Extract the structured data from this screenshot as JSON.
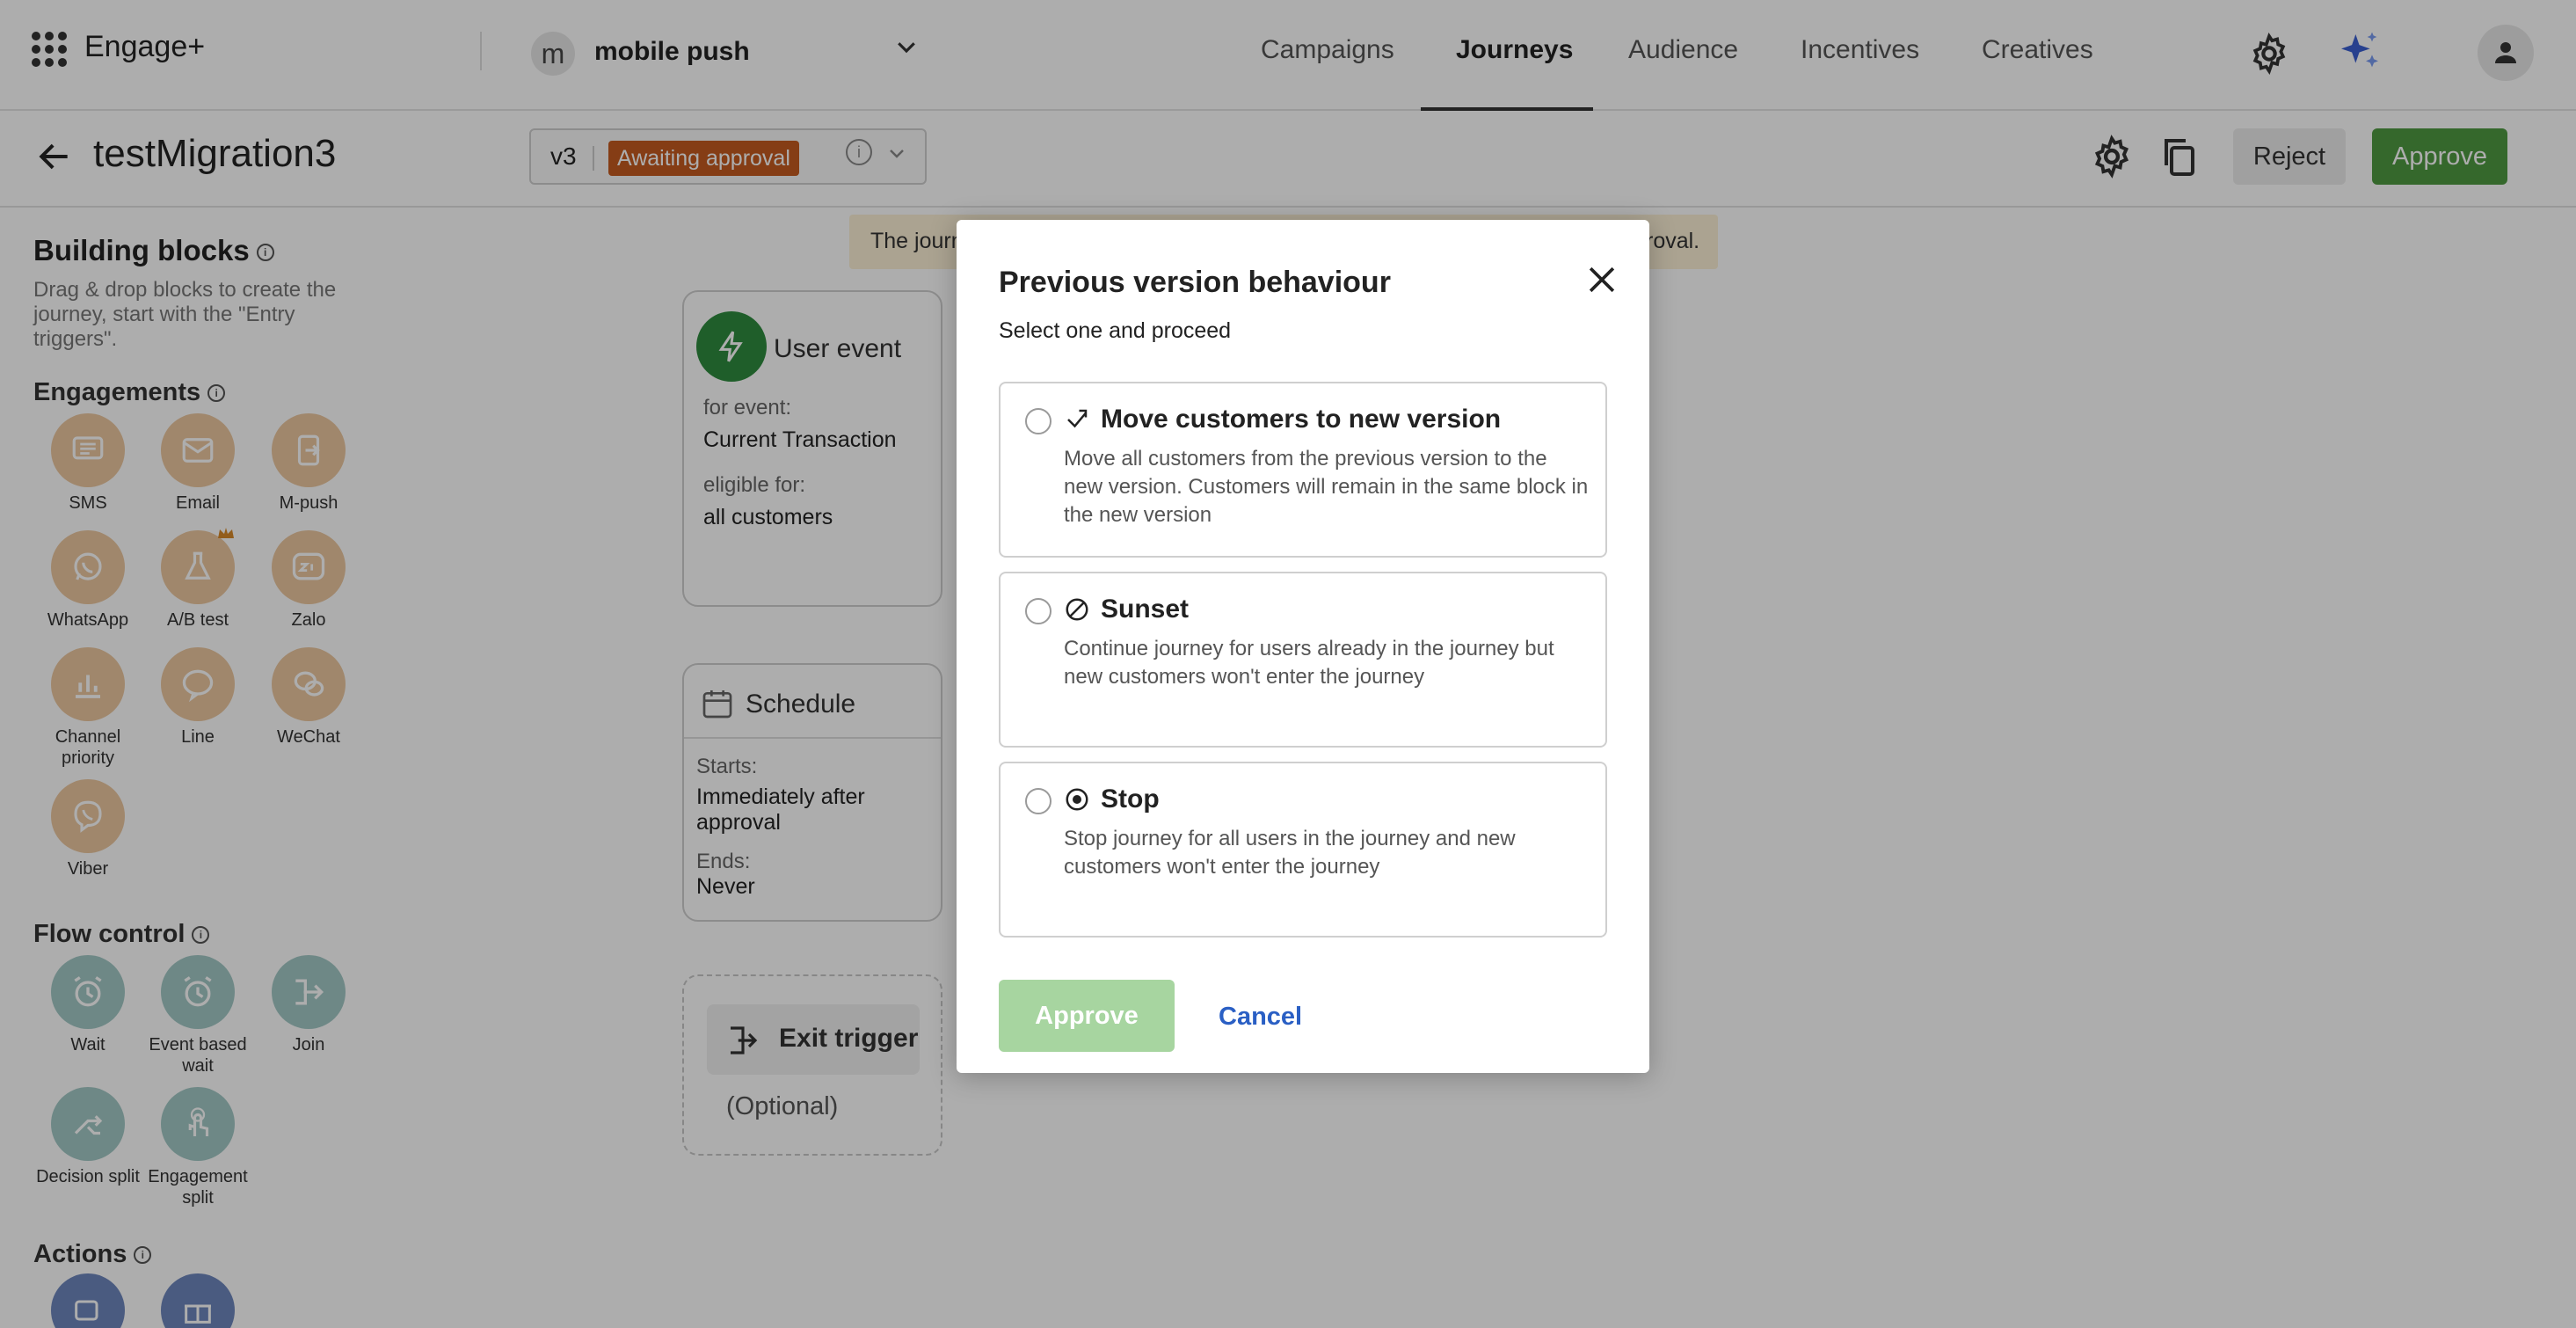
{
  "app": {
    "brand": "Engage+"
  },
  "project": {
    "avatar_letter": "m",
    "name": "mobile push"
  },
  "nav": {
    "tabs": [
      "Campaigns",
      "Journeys",
      "Audience",
      "Incentives",
      "Creatives"
    ],
    "active": "Journeys"
  },
  "journey": {
    "title": "testMigration3",
    "version": "v3",
    "status": "Awaiting approval"
  },
  "actions": {
    "reject_label": "Reject",
    "approve_label": "Approve"
  },
  "sidebar": {
    "title": "Building blocks",
    "description": "Drag & drop blocks to create the journey, start with the \"Entry triggers\".",
    "engagements_title": "Engagements",
    "engagements": [
      "SMS",
      "Email",
      "M-push",
      "WhatsApp",
      "A/B test",
      "Zalo",
      "Channel priority",
      "Line",
      "WeChat",
      "Viber"
    ],
    "flow_title": "Flow control",
    "flow": [
      "Wait",
      "Event based wait",
      "Join",
      "Decision split",
      "Engagement split"
    ],
    "actions_title": "Actions"
  },
  "canvas": {
    "banner_start": "The journ",
    "banner_end": "roval.",
    "user_event": {
      "title": "User event",
      "for_event_label": "for event:",
      "for_event_value": "Current Transaction",
      "eligible_label": "eligible for:",
      "eligible_value": "all customers"
    },
    "schedule": {
      "title": "Schedule",
      "starts_label": "Starts:",
      "starts_value": "Immediately after approval",
      "ends_label": "Ends:",
      "ends_value": "Never"
    },
    "exit_trigger": {
      "title": "Exit trigger",
      "optional": "(Optional)"
    }
  },
  "modal": {
    "title": "Previous version behaviour",
    "subtitle": "Select one and proceed",
    "options": [
      {
        "title": "Move customers to new version",
        "description": "Move all customers from the previous version to the new version. Customers will remain in the same block in the new version",
        "icon": "move-icon"
      },
      {
        "title": "Sunset",
        "description": "Continue journey for users already in the journey but new customers won't enter the journey",
        "icon": "sunset-icon"
      },
      {
        "title": "Stop",
        "description": "Stop journey for all users in the journey and new customers won't enter the journey",
        "icon": "stop-icon"
      }
    ],
    "approve_label": "Approve",
    "cancel_label": "Cancel"
  },
  "colors": {
    "approve": "#4f9a42",
    "approve_disabled": "#a7d5a0",
    "status_badge": "#c45b1f",
    "cancel_link": "#2a5fc4",
    "engagement": "#ecc79f",
    "flow": "#a3c9c6",
    "actions": "#6e86bd"
  }
}
